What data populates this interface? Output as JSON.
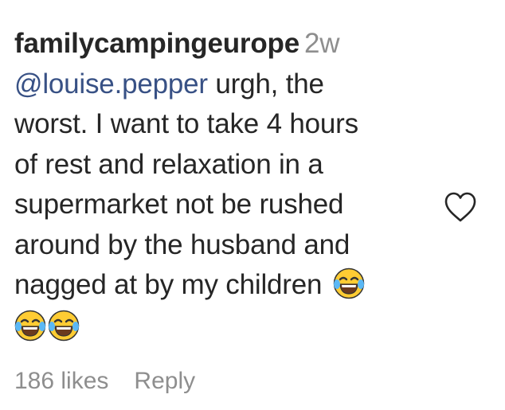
{
  "comment": {
    "username": "familycampingeurope",
    "timestamp": "2w",
    "mention": "@louise.pepper",
    "text_line1": "urgh, the",
    "text_line2": "worst. I want to take 4 hours",
    "text_line3": "of rest and relaxation in a",
    "text_line4": "supermarket not be rushed",
    "text_line5": "around by the husband and",
    "text_line6": "nagged at by my children",
    "emojis": [
      "face-with-tears-of-joy",
      "face-with-tears-of-joy",
      "face-with-tears-of-joy"
    ],
    "likes": "186 likes",
    "reply_label": "Reply",
    "like_icon": "heart-outline-icon"
  }
}
